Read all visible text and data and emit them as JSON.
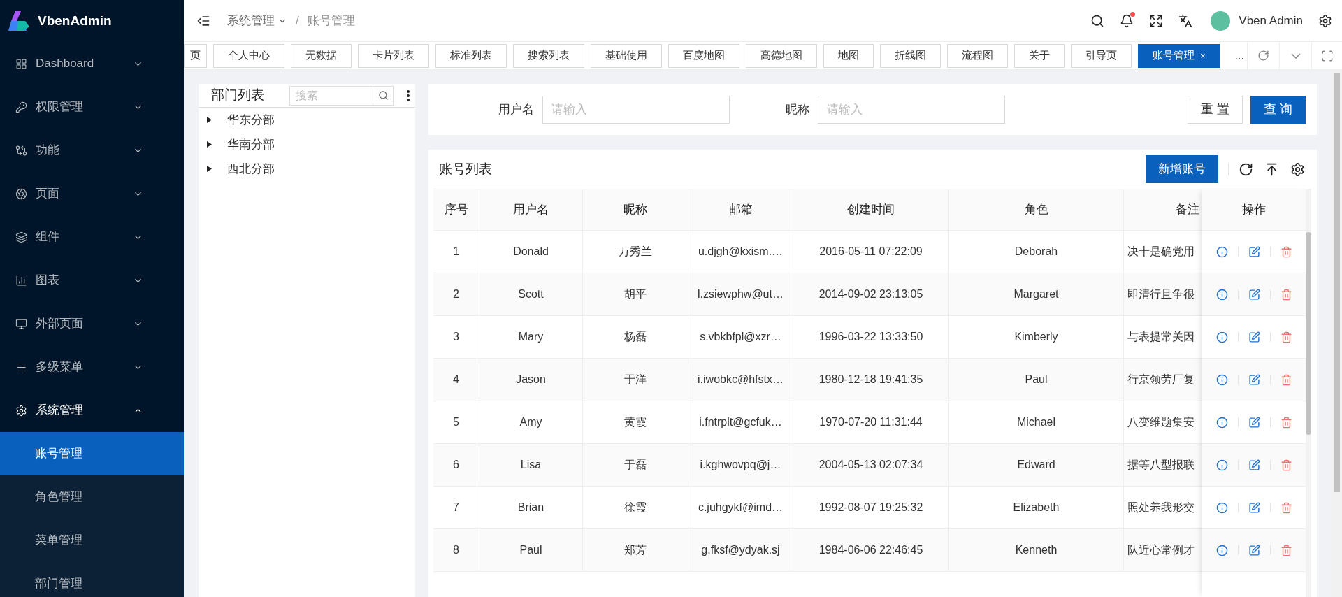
{
  "sidebar": {
    "logo_text": "VbenAdmin",
    "items": [
      {
        "label": "Dashboard",
        "expanded": false,
        "selected": false
      },
      {
        "label": "权限管理",
        "expanded": false,
        "selected": false
      },
      {
        "label": "功能",
        "expanded": false,
        "selected": false
      },
      {
        "label": "页面",
        "expanded": false,
        "selected": false
      },
      {
        "label": "组件",
        "expanded": false,
        "selected": false
      },
      {
        "label": "图表",
        "expanded": false,
        "selected": false
      },
      {
        "label": "外部页面",
        "expanded": false,
        "selected": false
      },
      {
        "label": "多级菜单",
        "expanded": false,
        "selected": false
      },
      {
        "label": "系统管理",
        "expanded": true,
        "selected": false,
        "children": [
          {
            "label": "账号管理",
            "selected": true
          },
          {
            "label": "角色管理",
            "selected": false
          },
          {
            "label": "菜单管理",
            "selected": false
          },
          {
            "label": "部门管理",
            "selected": false
          }
        ]
      }
    ]
  },
  "header": {
    "breadcrumb": [
      {
        "label": "系统管理",
        "has_menu": true
      },
      {
        "label": "账号管理",
        "has_menu": false
      }
    ],
    "separator": "/",
    "notification_dot": true,
    "user_name": "Vben Admin"
  },
  "tabs": [
    {
      "label": "页",
      "selected": false,
      "closable": false
    },
    {
      "label": "个人中心",
      "selected": false,
      "closable": false
    },
    {
      "label": "无数据",
      "selected": false,
      "closable": false
    },
    {
      "label": "卡片列表",
      "selected": false,
      "closable": false
    },
    {
      "label": "标准列表",
      "selected": false,
      "closable": false
    },
    {
      "label": "搜索列表",
      "selected": false,
      "closable": false
    },
    {
      "label": "基础使用",
      "selected": false,
      "closable": false
    },
    {
      "label": "百度地图",
      "selected": false,
      "closable": false
    },
    {
      "label": "高德地图",
      "selected": false,
      "closable": false
    },
    {
      "label": "地图",
      "selected": false,
      "closable": false
    },
    {
      "label": "折线图",
      "selected": false,
      "closable": false
    },
    {
      "label": "流程图",
      "selected": false,
      "closable": false
    },
    {
      "label": "关于",
      "selected": false,
      "closable": false
    },
    {
      "label": "引导页",
      "selected": false,
      "closable": false
    },
    {
      "label": "账号管理",
      "selected": true,
      "closable": true,
      "close": "×"
    }
  ],
  "tab_more": "...",
  "dept_panel": {
    "title": "部门列表",
    "search_placeholder": "搜索",
    "tree": [
      {
        "label": "华东分部",
        "expanded": false
      },
      {
        "label": "华南分部",
        "expanded": false
      },
      {
        "label": "西北分部",
        "expanded": false
      }
    ]
  },
  "search_form": {
    "fields": [
      {
        "label": "用户名",
        "placeholder": "请输入"
      },
      {
        "label": "昵称",
        "placeholder": "请输入"
      }
    ],
    "buttons": [
      {
        "label": "重 置",
        "kind": "default"
      },
      {
        "label": "查 询",
        "kind": "primary"
      }
    ]
  },
  "table": {
    "title": "账号列表",
    "add_button": "新增账号",
    "columns": [
      "序号",
      "用户名",
      "昵称",
      "邮箱",
      "创建时间",
      "角色",
      "备注",
      "操作"
    ],
    "rows": [
      [
        "1",
        "Donald",
        "万秀兰",
        "u.djgh@kxism.…",
        "2016-05-11 07:22:09",
        "Deborah",
        "决十是确党用"
      ],
      [
        "2",
        "Scott",
        "胡平",
        "l.zsiewphw@ut…",
        "2014-09-02 23:13:05",
        "Margaret",
        "即清行且争很"
      ],
      [
        "3",
        "Mary",
        "杨磊",
        "s.vbkbfpl@xzr…",
        "1996-03-22 13:33:50",
        "Kimberly",
        "与表提常关因"
      ],
      [
        "4",
        "Jason",
        "于洋",
        "i.iwobkc@hfstx…",
        "1980-12-18 19:41:35",
        "Paul",
        "行京领劳厂复"
      ],
      [
        "5",
        "Amy",
        "黄霞",
        "i.fntrplt@gcfuk…",
        "1970-07-20 11:31:44",
        "Michael",
        "八变维题集安"
      ],
      [
        "6",
        "Lisa",
        "于磊",
        "i.kghwovpq@j…",
        "2004-05-13 02:07:34",
        "Edward",
        "据等八型报联"
      ],
      [
        "7",
        "Brian",
        "徐霞",
        "c.juhgykf@imd…",
        "1992-08-07 19:25:32",
        "Elizabeth",
        "照处养我形交"
      ],
      [
        "8",
        "Paul",
        "郑芳",
        "g.fksf@ydyak.sj",
        "1984-06-06 22:46:45",
        "Kenneth",
        "队近心常例才"
      ]
    ]
  }
}
